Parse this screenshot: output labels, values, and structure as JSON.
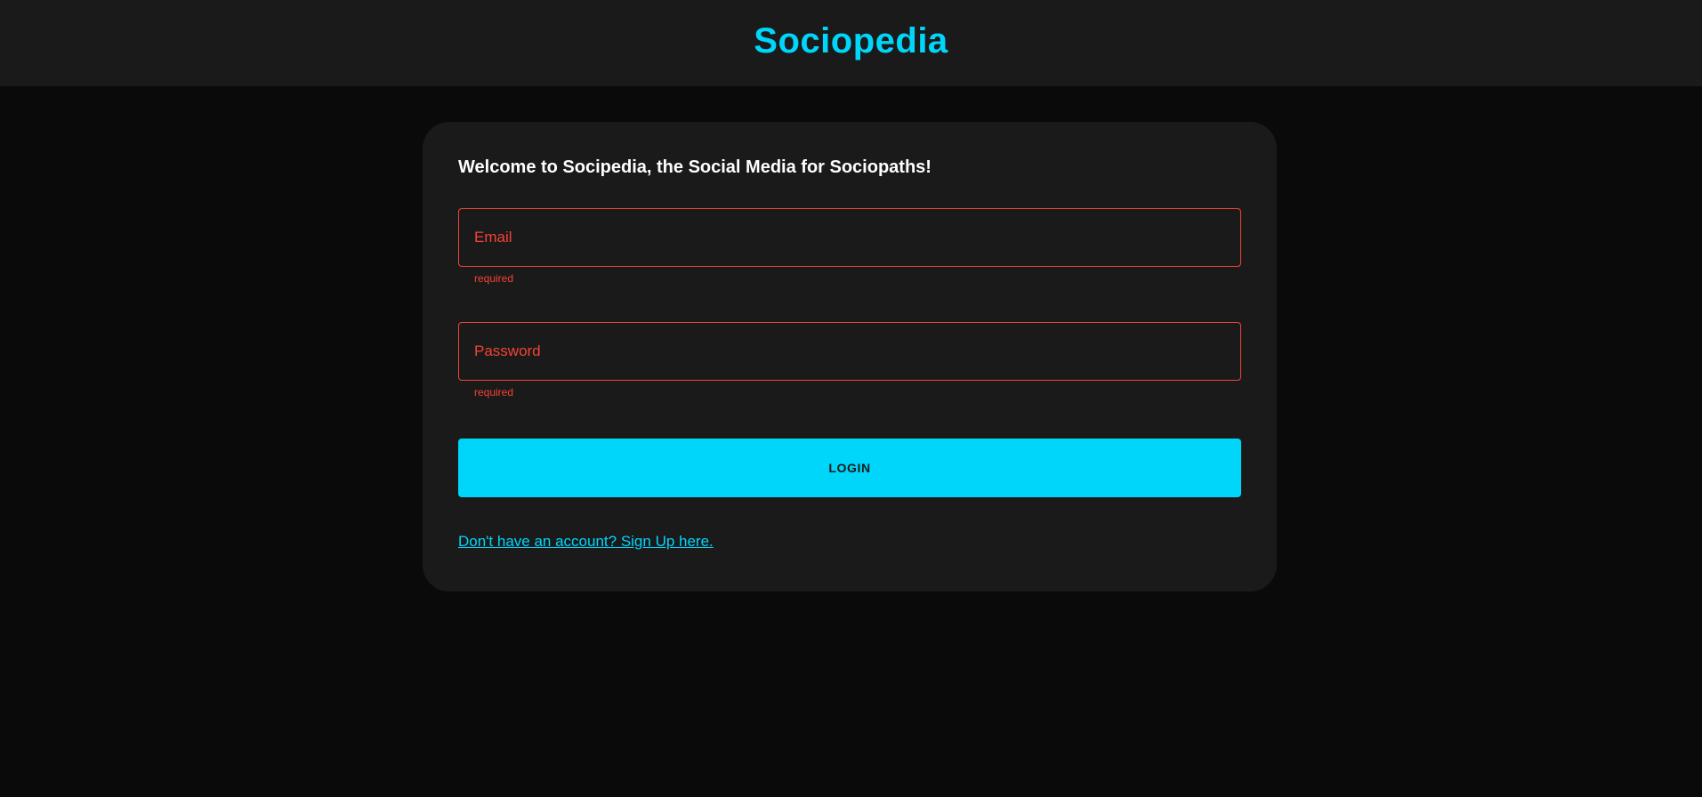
{
  "header": {
    "title": "Sociopedia"
  },
  "login": {
    "welcome": "Welcome to Socipedia, the Social Media for Sociopaths!",
    "email_placeholder": "Email",
    "email_value": "",
    "email_helper": "required",
    "password_placeholder": "Password",
    "password_value": "",
    "password_helper": "required",
    "login_label": "LOGIN",
    "signup_link": "Don't have an account? Sign Up here."
  },
  "colors": {
    "accent": "#00d5fa",
    "error": "#f44336",
    "background": "#0a0a0a",
    "surface": "#1a1a1a"
  }
}
